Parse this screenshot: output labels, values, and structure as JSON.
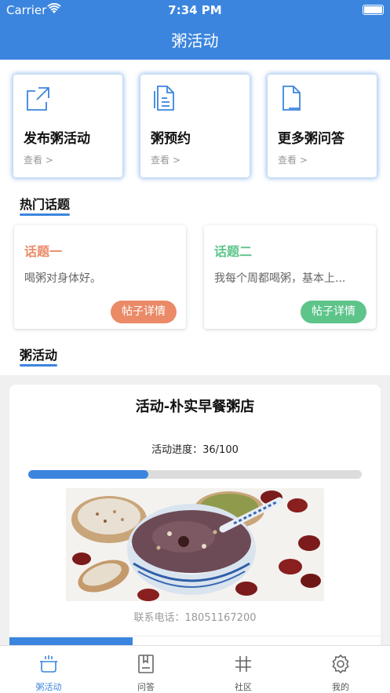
{
  "status_bar": {
    "carrier": "Carrier",
    "time": "7:34 PM"
  },
  "nav": {
    "title": "粥活动"
  },
  "quick_actions": [
    {
      "title": "发布粥活动",
      "sub": "查看 >",
      "icon": "share-external-icon"
    },
    {
      "title": "粥预约",
      "sub": "查看 >",
      "icon": "document-icon"
    },
    {
      "title": "更多粥问答",
      "sub": "查看 >",
      "icon": "file-minus-icon"
    }
  ],
  "sections": {
    "hot_topics": "热门话题",
    "activities": "粥活动"
  },
  "topics": [
    {
      "title": "话题一",
      "desc": "喝粥对身体好。",
      "button": "帖子详情",
      "color": "#ea8a67"
    },
    {
      "title": "话题二",
      "desc": "我每个周都喝粥，基本上...",
      "button": "帖子详情",
      "color": "#5dc48a"
    }
  ],
  "activity": {
    "title": "活动-朴实早餐粥店",
    "progress_text": "活动进度：36/100",
    "progress": 0.36,
    "phone_text": "联系电话：18051167200"
  },
  "tabbar": [
    {
      "label": "粥活动",
      "icon": "pot-icon",
      "active": true
    },
    {
      "label": "问答",
      "icon": "book-icon",
      "active": false
    },
    {
      "label": "社区",
      "icon": "hash-icon",
      "active": false
    },
    {
      "label": "我的",
      "icon": "gear-icon",
      "active": false
    }
  ],
  "colors": {
    "accent": "#3b85de"
  }
}
